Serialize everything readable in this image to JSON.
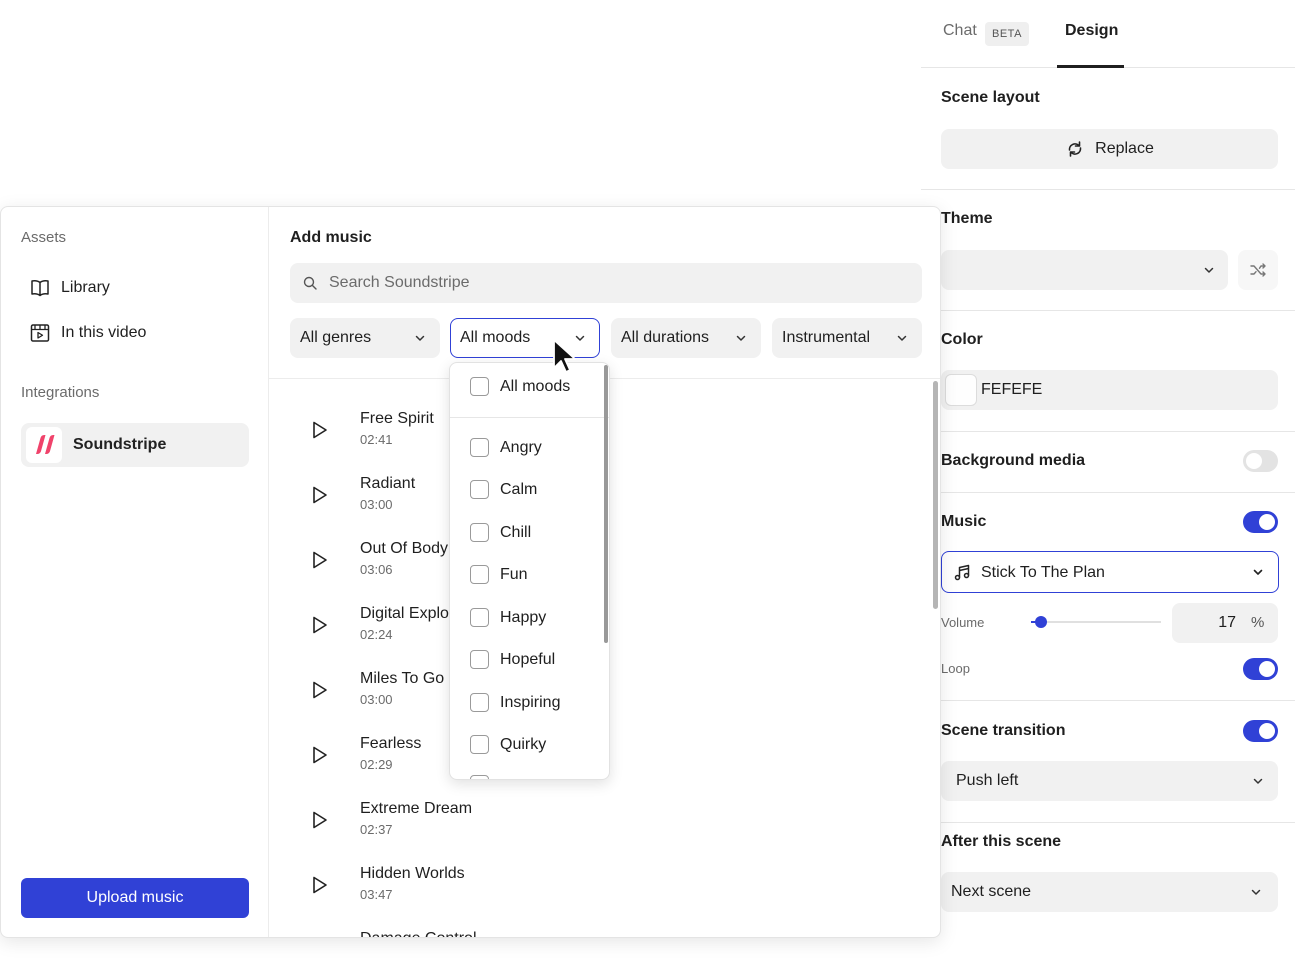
{
  "right_panel": {
    "tabs": [
      {
        "label": "Chat",
        "badge": "BETA"
      },
      {
        "label": "Design"
      }
    ],
    "scene_layout": {
      "label": "Scene layout",
      "button": "Replace"
    },
    "theme": {
      "label": "Theme",
      "value": ""
    },
    "color": {
      "label": "Color",
      "value": "FEFEFE",
      "swatch": "#fefefe"
    },
    "background_media": {
      "label": "Background media",
      "enabled": false
    },
    "music": {
      "label": "Music",
      "enabled": true,
      "selected": "Stick To The Plan",
      "volume_label": "Volume",
      "volume": 17,
      "volume_unit": "%",
      "loop_label": "Loop",
      "loop": true
    },
    "scene_transition": {
      "label": "Scene transition",
      "enabled": true,
      "value": "Push left"
    },
    "after_scene": {
      "label": "After this scene",
      "value": "Next scene"
    }
  },
  "modal": {
    "sidebar": {
      "assets_heading": "Assets",
      "library": "Library",
      "in_this_video": "In this video",
      "integrations_heading": "Integrations",
      "soundstripe": "Soundstripe",
      "upload_button": "Upload music"
    },
    "title": "Add music",
    "search_placeholder": "Search Soundstripe",
    "filters": [
      "All genres",
      "All moods",
      "All durations",
      "Instrumental"
    ],
    "tracks": [
      {
        "name": "Free Spirit",
        "duration": "02:41"
      },
      {
        "name": "Radiant",
        "duration": "03:00"
      },
      {
        "name": "Out Of Body",
        "duration": "03:06"
      },
      {
        "name": "Digital Explo",
        "duration": "02:24"
      },
      {
        "name": "Miles To Go",
        "duration": "03:00"
      },
      {
        "name": "Fearless",
        "duration": "02:29"
      },
      {
        "name": "Extreme Dream",
        "duration": "02:37"
      },
      {
        "name": "Hidden Worlds",
        "duration": "03:47"
      },
      {
        "name": "Damage Control",
        "duration": ""
      }
    ]
  },
  "mood_dropdown": {
    "all": "All moods",
    "options": [
      "Angry",
      "Calm",
      "Chill",
      "Fun",
      "Happy",
      "Hopeful",
      "Inspiring",
      "Quirky"
    ]
  },
  "colors": {
    "accent": "#3041d6",
    "panel_gray": "#f1f1f1",
    "soundstripe": "#f0436b"
  }
}
